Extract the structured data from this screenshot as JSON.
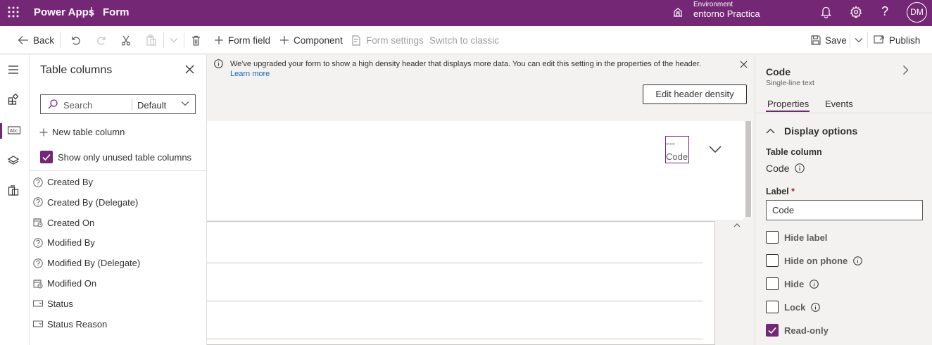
{
  "header": {
    "brand": "Power Apps",
    "separator": "|",
    "page": "Form",
    "environment_label": "Environment",
    "environment_name": "entorno Practica",
    "avatar": "DM"
  },
  "commands": {
    "back": "Back",
    "form_field": "Form field",
    "component": "Component",
    "form_settings": "Form settings",
    "switch_classic": "Switch to classic",
    "save": "Save",
    "publish": "Publish"
  },
  "panel": {
    "title": "Table columns",
    "search_placeholder": "Search",
    "filter_value": "Default",
    "new_column": "New table column",
    "show_unused": "Show only unused table columns",
    "columns": [
      {
        "label": "Created By",
        "icon": "question-circle-icon"
      },
      {
        "label": "Created By (Delegate)",
        "icon": "question-circle-icon"
      },
      {
        "label": "Created On",
        "icon": "calendar-icon"
      },
      {
        "label": "Modified By",
        "icon": "question-circle-icon"
      },
      {
        "label": "Modified By (Delegate)",
        "icon": "question-circle-icon"
      },
      {
        "label": "Modified On",
        "icon": "calendar-icon"
      },
      {
        "label": "Status",
        "icon": "dropdown-field-icon"
      },
      {
        "label": "Status Reason",
        "icon": "dropdown-field-icon"
      }
    ]
  },
  "canvas": {
    "banner_text": "We've upgraded your form to show a high density header that displays more data. You can edit this setting in the properties of the header.",
    "banner_link": "Learn more",
    "edit_density_button": "Edit header density",
    "header_field_value": "---",
    "header_field_label": "Code"
  },
  "properties": {
    "title": "Code",
    "subtitle": "Single-line text",
    "tab_properties": "Properties",
    "tab_events": "Events",
    "section": "Display options",
    "table_column_label": "Table column",
    "table_column_value": "Code",
    "label_label": "Label",
    "required_marker": "*",
    "label_value": "Code",
    "options": [
      {
        "label": "Hide label",
        "checked": false,
        "info": false
      },
      {
        "label": "Hide on phone",
        "checked": false,
        "info": true
      },
      {
        "label": "Hide",
        "checked": false,
        "info": true
      },
      {
        "label": "Lock",
        "checked": false,
        "info": true
      },
      {
        "label": "Read-only",
        "checked": true,
        "info": false
      }
    ]
  },
  "colors": {
    "brand": "#742774",
    "link": "#0f6cbd"
  }
}
